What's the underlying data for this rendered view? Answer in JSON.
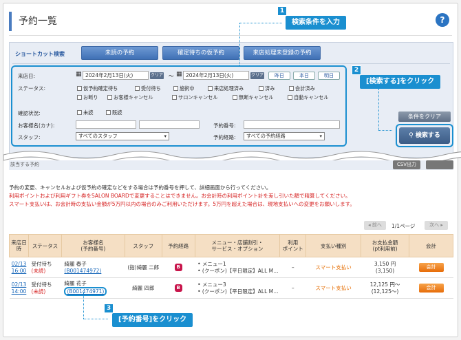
{
  "page": {
    "title": "予約一覧",
    "help": "?"
  },
  "shortcut": {
    "label": "ショートカット検索",
    "buttons": [
      "未読の予約",
      "確定待ちの仮予約",
      "来店処理未登録の予約"
    ]
  },
  "form": {
    "visit_date_label": "来店日:",
    "date_from": "2024年2月13日(火)",
    "date_to": "2024年2月13日(火)",
    "clear_small": "クリア",
    "range_sep": "〜",
    "quick": [
      "昨日",
      "本日",
      "明日"
    ],
    "status_label": "ステータス:",
    "status_row1": [
      "仮予約確定待ち",
      "受付待ち",
      "施術中",
      "来店処理済み",
      "済み",
      "会計済み"
    ],
    "status_row2": [
      "お断り",
      "お客様キャンセル",
      "サロンキャンセル",
      "無断キャンセル",
      "自動キャンセル"
    ],
    "confirm_label": "確認状況:",
    "confirm_options": [
      "未読",
      "既読"
    ],
    "name_label": "お客様名(カナ):",
    "rsv_no_label": "予約番号:",
    "staff_label": "スタッフ:",
    "staff_value": "すべてのスタッフ",
    "route_label": "予約経路:",
    "route_value": "すべての予約経路"
  },
  "buttons": {
    "clear_conditions": "条件をクリア",
    "search": "検索する",
    "csv": "CSV出力"
  },
  "strip_text": "該当する予約",
  "callouts": {
    "c1_num": "1",
    "c1_text": "検索条件を入力",
    "c2_num": "2",
    "c2_text": "[検索する]をクリック",
    "c3_num": "3",
    "c3_text": "[予約番号]をクリック"
  },
  "notes": [
    "予約の変更、キャンセルおよび仮予約の確定などをする場合は予約番号を押して、詳細画面から行ってください。",
    "利用ポイントおよび利用ギフト券をSALON BOARDで変更することはできません。お会計時の利用ポイント計を差し引いた額で精算してください。",
    "スマート支払いは、お会計時の支払い金額が5万円以内の場合のみご利用いただけます。5万円を超えた場合は、現地支払いへの変更をお願いします。"
  ],
  "pager": {
    "prev": "前へ",
    "info": "1/1ページ",
    "next": "次へ"
  },
  "table": {
    "headers": [
      "来店日時",
      "ステータス",
      "お客様名\n(予約番号)",
      "スタッフ",
      "予約経路",
      "メニュー・店舗割引・\nサービス・オプション",
      "利用\nポイント",
      "支払い種別",
      "お支払金額\n(pt利用前)",
      "会計"
    ],
    "rows": [
      {
        "date": "02/13",
        "time": "16:00",
        "status": "受付待ち",
        "status2": "(未読)",
        "name": "綺麗 春子",
        "rsv": "(B001474972)",
        "staff": "(指)綺麗 二郎",
        "route": "B",
        "menu1": "メニュー1",
        "menu2": "(クーポン)【平日限定】ALL M…",
        "points": "–",
        "pay_type": "スマート支払い",
        "amount": "3,150 円",
        "amount2": "(3,150)",
        "action": "会計"
      },
      {
        "date": "02/13",
        "time": "14:00",
        "status": "受付待ち",
        "status2": "(未読)",
        "name": "綺麗 花子",
        "rsv": "(B001474971)",
        "staff": "綺麗 四郎",
        "route": "B",
        "menu1": "メニュー3",
        "menu2": "(クーポン)【平日限定】ALL M…",
        "points": "–",
        "pay_type": "スマート支払い",
        "amount": "12,125 円〜",
        "amount2": "(12,125〜)",
        "action": "会計"
      }
    ]
  }
}
